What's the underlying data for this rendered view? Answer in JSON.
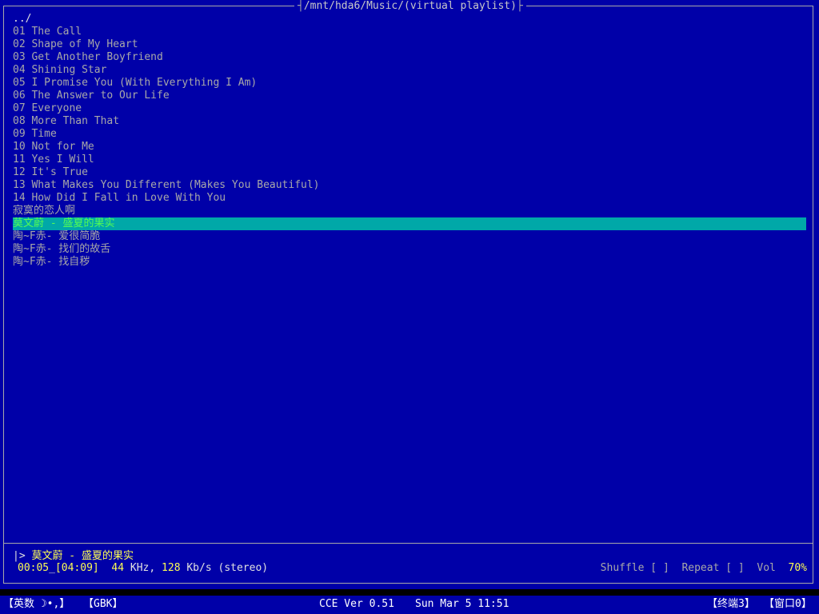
{
  "window": {
    "path": "/mnt/hda6/Music/(virtual playlist)"
  },
  "playlist": {
    "parent": "../",
    "items": [
      "01 The Call",
      "02 Shape of My Heart",
      "03 Get Another Boyfriend",
      "04 Shining Star",
      "05 I Promise You (With Everything I Am)",
      "06 The Answer to Our Life",
      "07 Everyone",
      "08 More Than That",
      "09 Time",
      "10 Not for Me",
      "11 Yes I Will",
      "12 It's True",
      "13 What Makes You Different (Makes You Beautiful)",
      "14 How Did I Fall in Love With You",
      "寂寞的恋人啊",
      "莫文蔚 - 盛夏的果实",
      "陶~F赤- 爱很简脆",
      "陶~F赤- 找们的故舌",
      "陶~F赤- 找自秽"
    ],
    "selected_index": 15
  },
  "player": {
    "marker": "|>",
    "now_playing": "莫文蔚 - 盛夏的果实",
    "elapsed": "00:05",
    "total": "[04:09]",
    "rate_value": "44",
    "rate_unit": "KHz,",
    "bitrate_value": "128",
    "bitrate_unit": "Kb/s",
    "channels": "(stereo)",
    "shuffle_label": "Shuffle",
    "shuffle_box": "[ ]",
    "repeat_label": "Repeat",
    "repeat_box": "[ ]",
    "vol_label": "Vol",
    "vol_value": "70%"
  },
  "taskbar": {
    "input_method": "【英数 ☽•,】",
    "encoding": "【GBK】",
    "version": "CCE Ver 0.51",
    "datetime": "Sun Mar 5 11:51",
    "terminal": "【终端3】",
    "window": "【窗口0】"
  },
  "colors": {
    "background": "#0000a8",
    "text": "#a8a8a8",
    "selection_bg": "#00a8a8",
    "selection_fg": "#54fc54",
    "highlight": "#fcfc54"
  }
}
